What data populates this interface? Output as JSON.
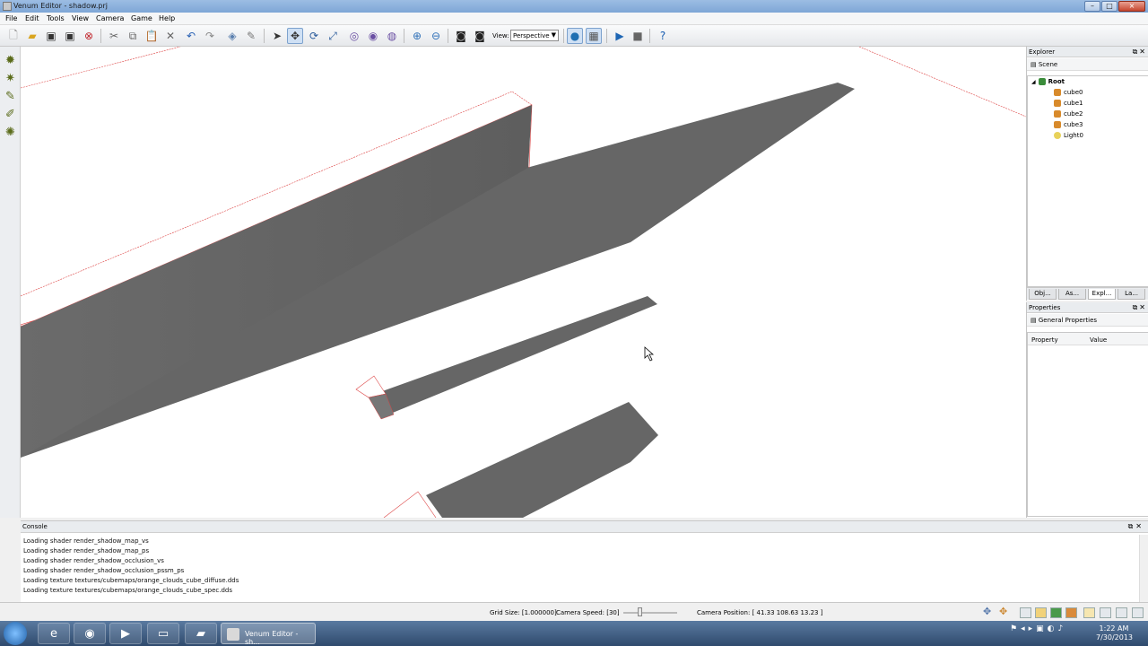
{
  "window": {
    "title": "Venum Editor - shadow.prj"
  },
  "menu": [
    "File",
    "Edit",
    "Tools",
    "View",
    "Camera",
    "Game",
    "Help"
  ],
  "toolbar": {
    "view_label": "View:",
    "view_value": "Perspective"
  },
  "explorer": {
    "title": "Explorer",
    "scene_label": "Scene",
    "root_label": "Root",
    "items": [
      "cube0",
      "cube1",
      "cube2",
      "cube3",
      "Light0"
    ],
    "tabs": [
      "Obj...",
      "As...",
      "Expl...",
      "La..."
    ]
  },
  "properties": {
    "title": "Properties",
    "general_label": "General Properties",
    "col_property": "Property",
    "col_value": "Value"
  },
  "console": {
    "title": "Console",
    "lines": [
      "Loading shader render_shadow_map_vs",
      "Loading shader render_shadow_map_ps",
      "Loading shader render_shadow_occlusion_vs",
      "Loading shader render_shadow_occlusion_pssm_ps",
      "Loading texture textures/cubemaps/orange_clouds_cube_diffuse.dds",
      "Loading texture textures/cubemaps/orange_clouds_cube_spec.dds"
    ]
  },
  "status": {
    "grid_size": "Grid Size: [1.000000]",
    "camera_speed": "Camera Speed: [30]",
    "camera_position": "Camera Position: [ 41.33 108.63 13.23 ]"
  },
  "taskbar": {
    "active_item": "Venum Editor - sh...",
    "time": "1:22 AM",
    "date": "7/30/2013"
  }
}
